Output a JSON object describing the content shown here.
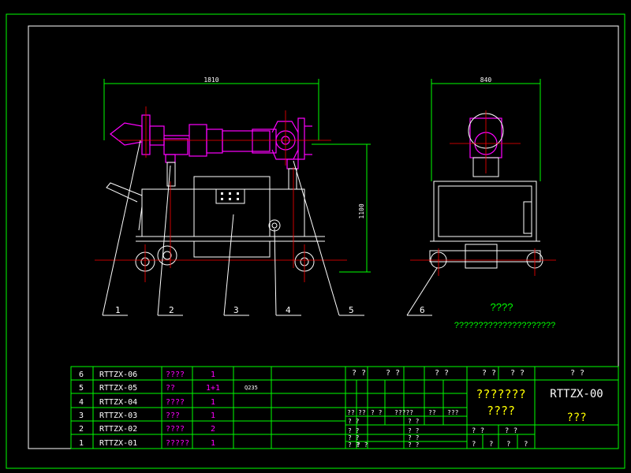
{
  "colors": {
    "frame": "#00ff00",
    "outline": "#ffffff",
    "part": "#ff00ff",
    "center": "#ff0000",
    "text": "#ffffff",
    "chinese": "#ffff00",
    "dimension": "#00ff00"
  },
  "dimensions": {
    "front_width": "1810",
    "side_width": "840",
    "height": "1100"
  },
  "callouts": [
    "1",
    "2",
    "3",
    "4",
    "5",
    "6"
  ],
  "notes": {
    "title": "????",
    "text": "?????????????????????"
  },
  "bom": [
    {
      "no": "6",
      "code": "RTTZX-06",
      "name": "????",
      "qty": "1",
      "material": ""
    },
    {
      "no": "5",
      "code": "RTTZX-05",
      "name": "??",
      "qty": "1+1",
      "material": "Q235"
    },
    {
      "no": "4",
      "code": "RTTZX-04",
      "name": "????",
      "qty": "1",
      "material": ""
    },
    {
      "no": "3",
      "code": "RTTZX-03",
      "name": "???",
      "qty": "1",
      "material": ""
    },
    {
      "no": "2",
      "code": "RTTZX-02",
      "name": "????",
      "qty": "2",
      "material": ""
    },
    {
      "no": "1",
      "code": "RTTZX-01",
      "name": "?????",
      "qty": "1",
      "material": ""
    }
  ],
  "title_block": {
    "head_a": "? ?",
    "head_b": "? ?",
    "head_c": "? ?",
    "head_d": "? ?",
    "head_e": "? ?",
    "head_f": "? ?",
    "product_name_1": "???????",
    "product_name_2": "????",
    "drawing_no": "RTTZX-00",
    "drawing_sub": "???",
    "row_labels": [
      "??",
      "??",
      "? ?",
      "?????",
      "??",
      "???"
    ],
    "sign_rows": [
      "? ?",
      "? ?",
      "? ?",
      "? ?"
    ],
    "sign_mid": [
      "? ?",
      "? ?",
      "? ?",
      "? ?",
      "? ?"
    ],
    "scale_row": [
      "? ?",
      "? ?"
    ],
    "sheet_row": [
      "?",
      "?",
      "?",
      "?"
    ]
  }
}
